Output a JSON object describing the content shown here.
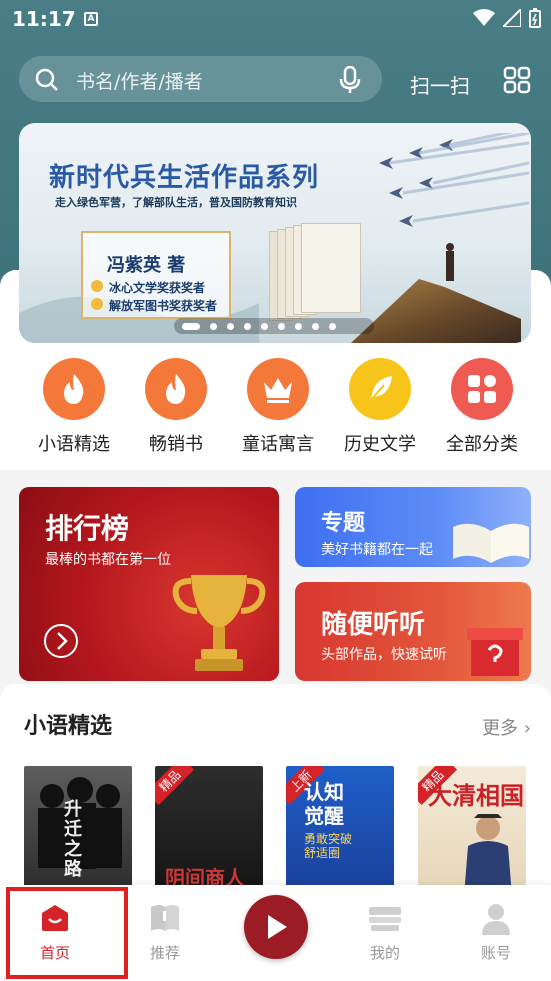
{
  "status": {
    "time": "11:17",
    "badge": "A"
  },
  "search": {
    "placeholder": "书名/作者/播者"
  },
  "header": {
    "scan_label": "扫一扫"
  },
  "banner": {
    "title": "新时代兵生活作品系列",
    "subtitle": "走入绿色军营，了解部队生活，普及国防教育知识",
    "author": "冯紫英  著",
    "awards": [
      "冰心文学奖获奖者",
      "解放军图书奖获奖者"
    ],
    "slide_count": 10,
    "active_slide": 0
  },
  "categories": [
    {
      "label": "小语精选",
      "icon": "flame-icon",
      "color": "#f3783a"
    },
    {
      "label": "畅销书",
      "icon": "flame-icon",
      "color": "#f3783a"
    },
    {
      "label": "童话寓言",
      "icon": "crown-icon",
      "color": "#f3783a"
    },
    {
      "label": "历史文学",
      "icon": "feather-icon",
      "color": "#f7c51a"
    },
    {
      "label": "全部分类",
      "icon": "grid-icon",
      "color": "#ef5a52"
    }
  ],
  "promos": {
    "ranking": {
      "title": "排行榜",
      "subtitle": "最棒的书都在第一位"
    },
    "topic": {
      "title": "专题",
      "subtitle": "美好书籍都在一起"
    },
    "listen": {
      "title": "随便听听",
      "subtitle": "头部作品，快速试听"
    }
  },
  "section": {
    "title": "小语精选",
    "more": "更多",
    "books": [
      {
        "cover_text": "升迁之路",
        "tag": ""
      },
      {
        "cover_text": "阴间商人",
        "tag": "精品"
      },
      {
        "cover_text": "认知觉醒",
        "tag": "上新",
        "sub": "勇敢突破 舒适圈"
      },
      {
        "cover_text": "大清相国",
        "tag": "精品"
      }
    ]
  },
  "nav": {
    "items": [
      {
        "label": "首页",
        "icon": "home-icon",
        "active": true
      },
      {
        "label": "推荐",
        "icon": "book-icon",
        "active": false
      },
      {
        "label": "我的",
        "icon": "bookshelf-icon",
        "active": false
      },
      {
        "label": "账号",
        "icon": "user-icon",
        "active": false
      }
    ]
  },
  "colors": {
    "accent": "#d6232a",
    "header": "#4a7e86"
  }
}
